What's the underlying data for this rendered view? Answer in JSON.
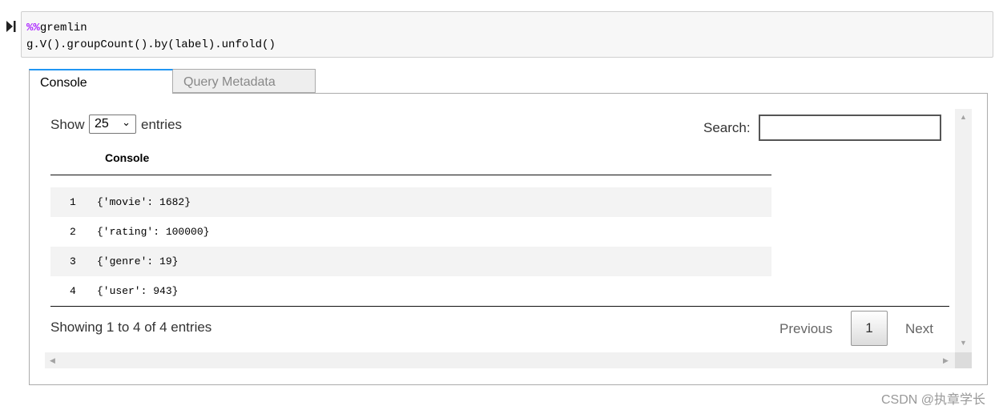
{
  "cell": {
    "magic_prefix": "%%",
    "magic_name": "gremlin",
    "code_line": "g.V().groupCount().by(label).unfold()",
    "magic_color": "#aa22ff"
  },
  "tabs": [
    {
      "label": "Console",
      "active": true
    },
    {
      "label": "Query Metadata",
      "active": false
    }
  ],
  "accent_color": "#2196f3",
  "table": {
    "show_label": "Show",
    "page_size": "25",
    "entries_label": "entries",
    "search_label": "Search:",
    "search_value": "",
    "column_header": "Console",
    "rows": [
      {
        "index": "1",
        "value": "{'movie': 1682}"
      },
      {
        "index": "2",
        "value": "{'rating': 100000}"
      },
      {
        "index": "3",
        "value": "{'genre': 19}"
      },
      {
        "index": "4",
        "value": "{'user': 943}"
      }
    ],
    "info": "Showing 1 to 4 of 4 entries",
    "previous_label": "Previous",
    "current_page": "1",
    "next_label": "Next"
  },
  "watermark": "CSDN @执章学长"
}
